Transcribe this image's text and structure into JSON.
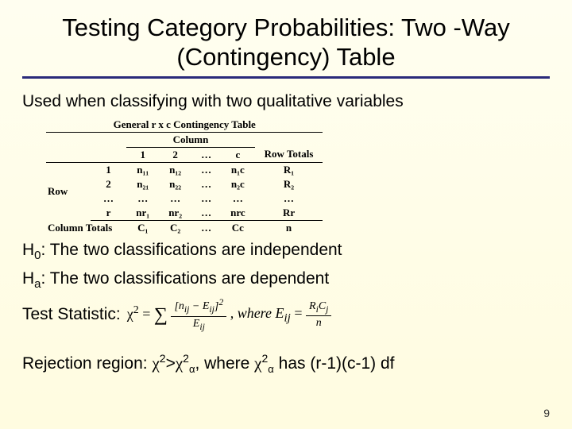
{
  "title": "Testing Category Probabilities: Two -Way (Contingency) Table",
  "intro": "Used when classifying with two qualitative variables",
  "table": {
    "caption": "General r x c Contingency Table",
    "column_group": "Column",
    "row_label": "Row",
    "col_totals_label": "Column Totals",
    "row_totals_label": "Row Totals",
    "cols": [
      "1",
      "2",
      "…",
      "c"
    ],
    "rows": [
      {
        "label": "1",
        "cells": [
          "n₁₁",
          "n₁₂",
          "…",
          "n₁c"
        ],
        "total": "R₁"
      },
      {
        "label": "2",
        "cells": [
          "n₂₁",
          "n₂₂",
          "…",
          "n₂c"
        ],
        "total": "R₂"
      },
      {
        "label": "…",
        "cells": [
          "…",
          "…",
          "…",
          "…"
        ],
        "total": "…"
      },
      {
        "label": "r",
        "cells": [
          "nr₁",
          "nr₂",
          "…",
          "nrc"
        ],
        "total": "Rr"
      }
    ],
    "col_totals": [
      "C₁",
      "C₂",
      "…",
      "Cc"
    ],
    "grand_total": "n"
  },
  "hypotheses": {
    "h0_label": "H",
    "h0_sub": "0",
    "h0_text": ": The two classifications are independent",
    "ha_label": "H",
    "ha_sub": "a",
    "ha_text": ": The two classifications are dependent"
  },
  "test_stat_label": "Test Statistic:",
  "formula": {
    "lhs": "χ² = ∑",
    "num": "[nᵢⱼ − Eᵢⱼ]²",
    "den": "Eᵢⱼ",
    "where": ", where Eᵢⱼ =",
    "num2": "RᵢCⱼ",
    "den2": "n"
  },
  "rejection": {
    "prefix": "Rejection region: ",
    "chi": "χ",
    "sup2": "2",
    "gt": ">",
    "alpha": "α",
    "mid": ", where ",
    "tail": " has (r-1)(c-1) df"
  },
  "page": "9"
}
